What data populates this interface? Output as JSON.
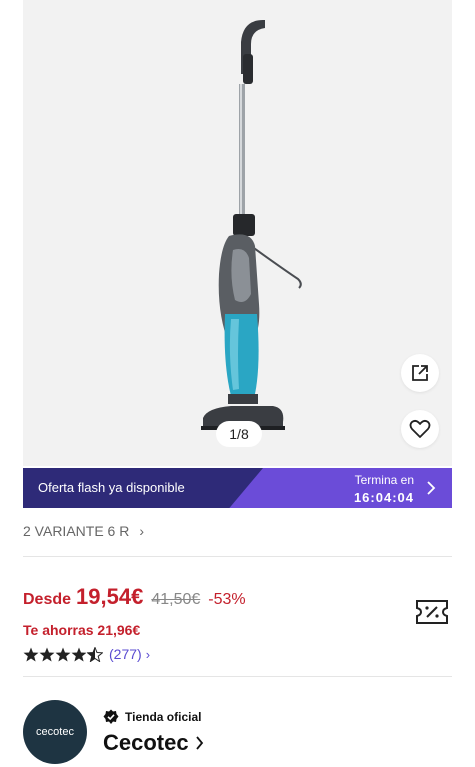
{
  "gallery": {
    "image_counter": "1/8",
    "share_icon": "share-external-icon",
    "favorite_icon": "heart-outline-icon"
  },
  "flash_banner": {
    "label": "Oferta flash ya disponible",
    "ends_label": "Termina en",
    "countdown": "16:04:04"
  },
  "variants": {
    "label": "2 VARIANTE 6 R"
  },
  "pricing": {
    "from_label": "Desde",
    "price": "19,54€",
    "original_price": "41,50€",
    "discount": "-53%",
    "savings": "Te ahorras 21,96€"
  },
  "rating": {
    "stars": 4.5,
    "count": "(277)"
  },
  "store": {
    "badge": "Tienda oficial",
    "name": "Cecotec",
    "logo_text": "cecotec"
  },
  "colors": {
    "price_red": "#c4202c",
    "flash_dark": "#2e2a78",
    "flash_light": "#6b4cd8",
    "rating_link": "#5a4bd1"
  }
}
